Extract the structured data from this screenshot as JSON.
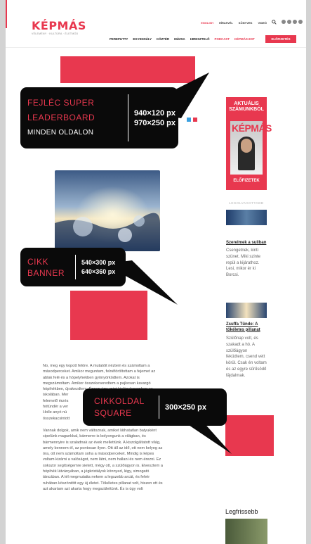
{
  "header": {
    "logo": "KÉPMÁS",
    "logo_tagline": "VÉLEMÉNY · KULTÚRA · ÉLETMÓD",
    "top_nav": [
      "ENGLISH",
      "HÍRLEVÉL",
      "KÖNYVEK",
      "VIDEÓ"
    ],
    "main_nav": [
      "PEREPUTTY",
      "EGYENSÚLY",
      "KÖZTÉR",
      "MÚZSA",
      "HIRESZTELŐ",
      "PODCAST",
      "KÉPMÁS-EST"
    ],
    "subscribe": "ELŐFIZETÉS"
  },
  "callouts": {
    "super": {
      "label_line1": "FEJLÉC SUPER",
      "label_line2": "LEADERBOARD",
      "sub": "MINDEN OLDALON",
      "size1": "940×120 px",
      "size2": "970×250 px"
    },
    "banner": {
      "label_line1": "CIKK",
      "label_line2": "BANNER",
      "size1": "540×300 px",
      "size2": "640×360 px"
    },
    "square": {
      "label_line1": "CIKKOLDAL",
      "label_line2": "SQUARE",
      "size1": "300×250 px"
    }
  },
  "article": {
    "lead": [
      "vett körül. Csak én voltam és az egyre sűrűsödő fájdalmak."
    ],
    "para1": [
      "No, meg egy kopott felöre. A mutatóit néztem és számoltam a",
      "másodperceket. Amikor meguntam, felnéföröltottam a fejemet az",
      "ablak felé és a hópelyhekben gyönyörködtem. Azokat is",
      "megszámoltam. Amikor összekeveredtem a pajkosan kavargó",
      "hópihékben, újrakezdtem. Éppen úgy, mint kislánykoromban az",
      "iskolában. Mer",
      "felemelő érzés",
      "hótündér a ver",
      "Holle anyó nú",
      "összekacsintott"
    ],
    "para2": [
      "Vannak dolgok, amik nem változnak, amiket láthatatlan batyuként",
      "cipelünk magunkkal, bármerre is bolyongunk a világban, és",
      "bármennyire is szaladnak az évek mellettünk. A kiszolgáltatott világ,",
      "amely bennem él, az pontosan ilyen. Ott áll az idő, ott nem kelyeg az",
      "óra, ott nem számoltam soha a másodperceket. Mindig is képes",
      "voltam kizárni a valóságot, nem látni, nem hallani és nem érezni. Ez",
      "sokszor segítségemre sietett, mégy ott, a szülőágyon is. Elvesztem a",
      "hópihék látványában, a jégkristályok könnyed, légy, simogató",
      "táncában. A tél megmutatta nekem a legszebb arcát, és fehér",
      "ruhában köszöntött egy új életet. Tökéletes pillanat volt, hiszen ott és",
      "azt akartam azt akarta hogy megszülettünk. És is úgy volt"
    ]
  },
  "sidebar": {
    "promo_title_line1": "AKTUÁLIS",
    "promo_title_line2": "SZÁMUNKBÓL",
    "magazine_word": "KÉPMÁS",
    "promo_button": "ELŐFIZETEK",
    "popular_label": "LEGOLVASOTTABB",
    "items": [
      {
        "title": "Szerelmek a suliban",
        "text": [
          "Csengetnek, kinti",
          "szünet. Miki szinte",
          "repül a kijárathoz.",
          "Lesi, mikor ér ki",
          "Borcsi."
        ]
      },
      {
        "title": "Zsuffa Tünde: A tökéletes pillanat",
        "text": [
          "Szülőnap volt, és",
          "szakadt a hó. A",
          "szülőágyon",
          "feküdtem, csend vett",
          "körül. Csak én voltam",
          "és az egyre sűrűsödő",
          "fájdalmak."
        ]
      }
    ],
    "latest_label": "Legfrissebb"
  },
  "colors": {
    "accent": "#e8384f",
    "callout_bg": "#0a0a0a"
  }
}
